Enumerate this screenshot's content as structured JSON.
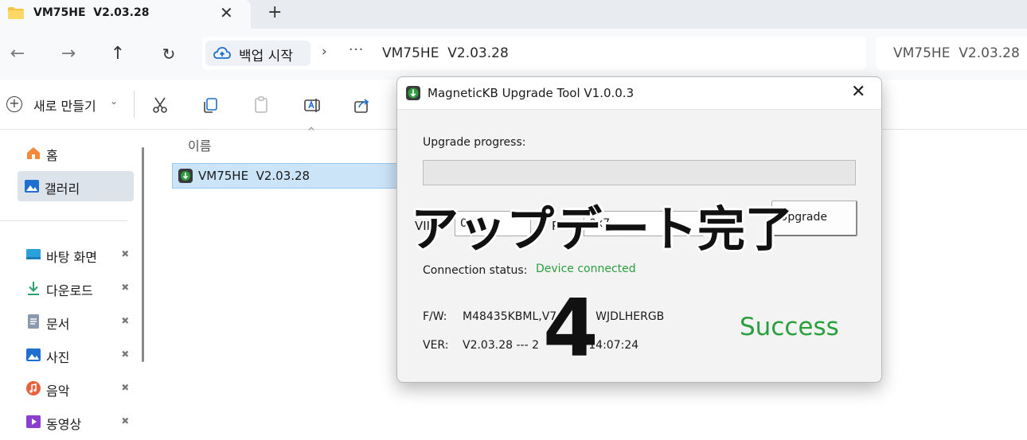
{
  "explorer": {
    "tab": {
      "title": "VM75HE  V2.03.28",
      "close_glyph": "✕",
      "new_glyph": "+"
    },
    "nav": {
      "back": "←",
      "forward": "→",
      "up": "↑",
      "refresh": "↻"
    },
    "address": {
      "root_label": "백업 시작",
      "separator": "›",
      "more": "···",
      "current": "VM75HE  V2.03.28"
    },
    "search_text": "VM75HE  V2.03.28 ",
    "command_bar": {
      "new_label": "새로 만들기",
      "new_chevron": "⌄"
    },
    "sidebar": {
      "items": [
        {
          "label": "홈",
          "icon": "home-icon"
        },
        {
          "label": "갤러리",
          "icon": "gallery-icon",
          "selected": true
        },
        {
          "label": "바탕 화면",
          "icon": "desktop-icon",
          "pinned": true
        },
        {
          "label": "다운로드",
          "icon": "download-icon",
          "pinned": true
        },
        {
          "label": "문서",
          "icon": "document-icon",
          "pinned": true
        },
        {
          "label": "사진",
          "icon": "pictures-icon",
          "pinned": true
        },
        {
          "label": "음악",
          "icon": "music-icon",
          "pinned": true
        },
        {
          "label": "동영상",
          "icon": "video-icon",
          "pinned": true
        }
      ],
      "pin_glyph": "📌"
    },
    "file_list": {
      "column_name": "이름",
      "sort_caret": "^",
      "files": [
        {
          "name": "VM75HE  V2.03.28"
        }
      ]
    }
  },
  "dialog": {
    "title": "MagneticKB Upgrade Tool V1.0.0.3",
    "close_glyph": "✕",
    "progress_label": "Upgrade progress:",
    "progress_percent": 0,
    "vid_label": "VID:",
    "vid_value": "0",
    "pid_label": "PID:",
    "pid_value": "0x7",
    "upgrade_button": "Upgrade",
    "connection_label": "Connection status:",
    "connection_value": "Device connected",
    "fw_label": "F/W:",
    "fw_value": "M48435KBML,V7           WJDLHERGB",
    "ver_label": "VER:",
    "ver_value": "V2.03.28 --- 2              14:07:24",
    "result": "Success"
  },
  "overlay": {
    "caption": "アップデート完了",
    "step_number": "4"
  },
  "colors": {
    "success_green": "#2aa03c",
    "selection_blue": "#cce4f7",
    "folder_yellow": "#f4c542",
    "app_icon_green": "#2e9e3e"
  }
}
